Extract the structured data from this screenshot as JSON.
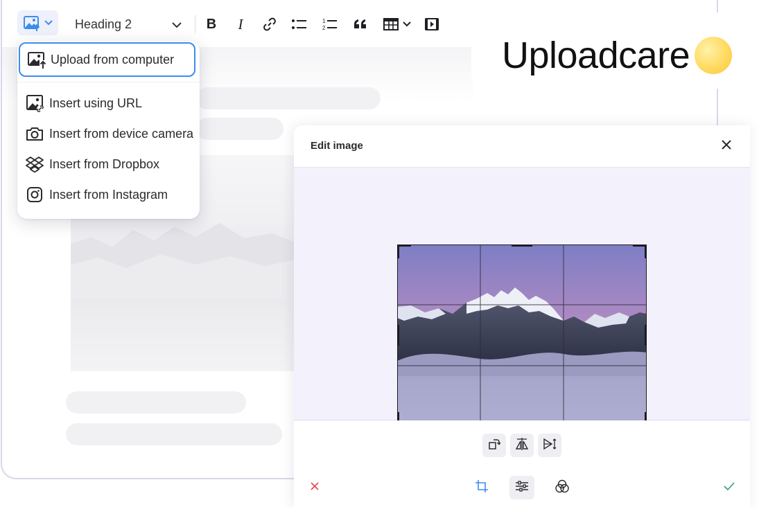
{
  "toolbar": {
    "heading_select": "Heading 2",
    "bold_label": "B",
    "italic_label": "I"
  },
  "dropdown": {
    "items": [
      {
        "label": "Upload from computer",
        "icon": "image-upload-icon"
      },
      {
        "label": "Insert using URL",
        "icon": "image-link-icon"
      },
      {
        "label": "Insert from device camera",
        "icon": "camera-icon"
      },
      {
        "label": "Insert from Dropbox",
        "icon": "dropbox-icon"
      },
      {
        "label": "Insert from Instagram",
        "icon": "instagram-icon"
      }
    ]
  },
  "brand": {
    "name": "Uploadcare"
  },
  "edit_image": {
    "title": "Edit image"
  },
  "colors": {
    "accent": "#3b8cf0",
    "cancel": "#e5484d",
    "confirm": "#2f9e7a",
    "tool_active": "#3b8cf0"
  }
}
